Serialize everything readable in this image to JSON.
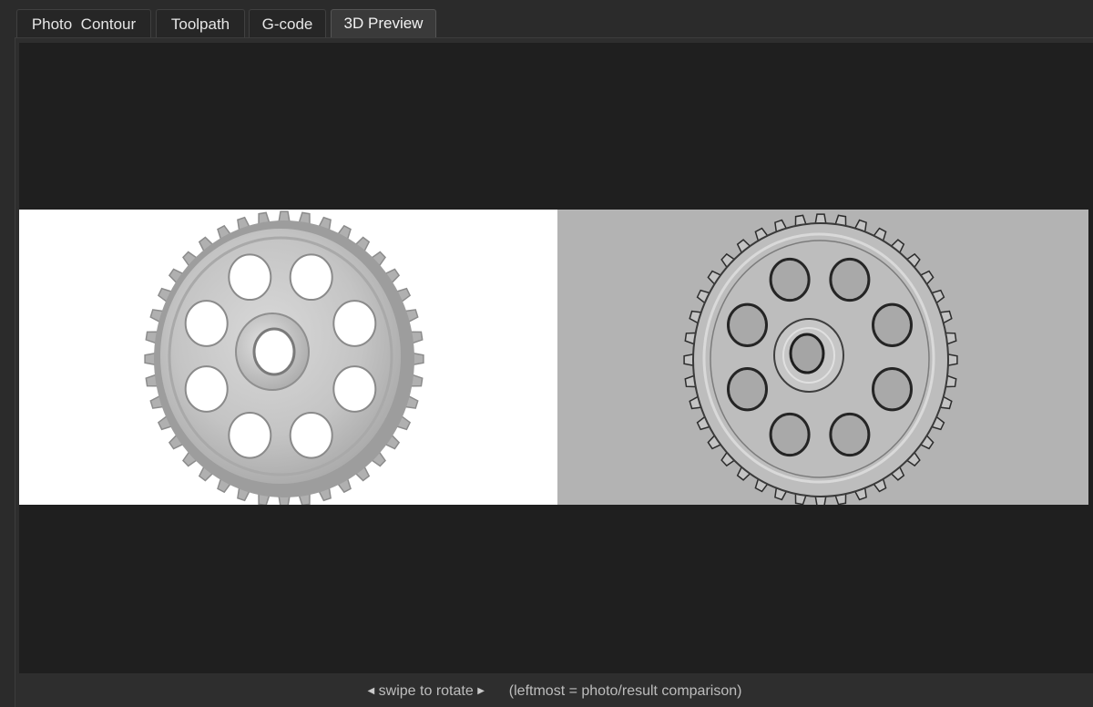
{
  "tabs": [
    {
      "label": "Photo  Contour",
      "active": false
    },
    {
      "label": "Toolpath",
      "active": false
    },
    {
      "label": "G-code",
      "active": false
    },
    {
      "label": "3D Preview",
      "active": true
    }
  ],
  "preview": {
    "left_panel": "photo",
    "right_panel": "relief result",
    "left_background": "#ffffff",
    "right_background": "#b3b3b3",
    "viewport_background": "#1f1f1f"
  },
  "status": {
    "left_arrow_icon": "triangle-left-icon",
    "swipe_text": "swipe to rotate",
    "right_arrow_icon": "triangle-right-icon",
    "hint_text": "(leftmost = photo/result comparison)"
  }
}
